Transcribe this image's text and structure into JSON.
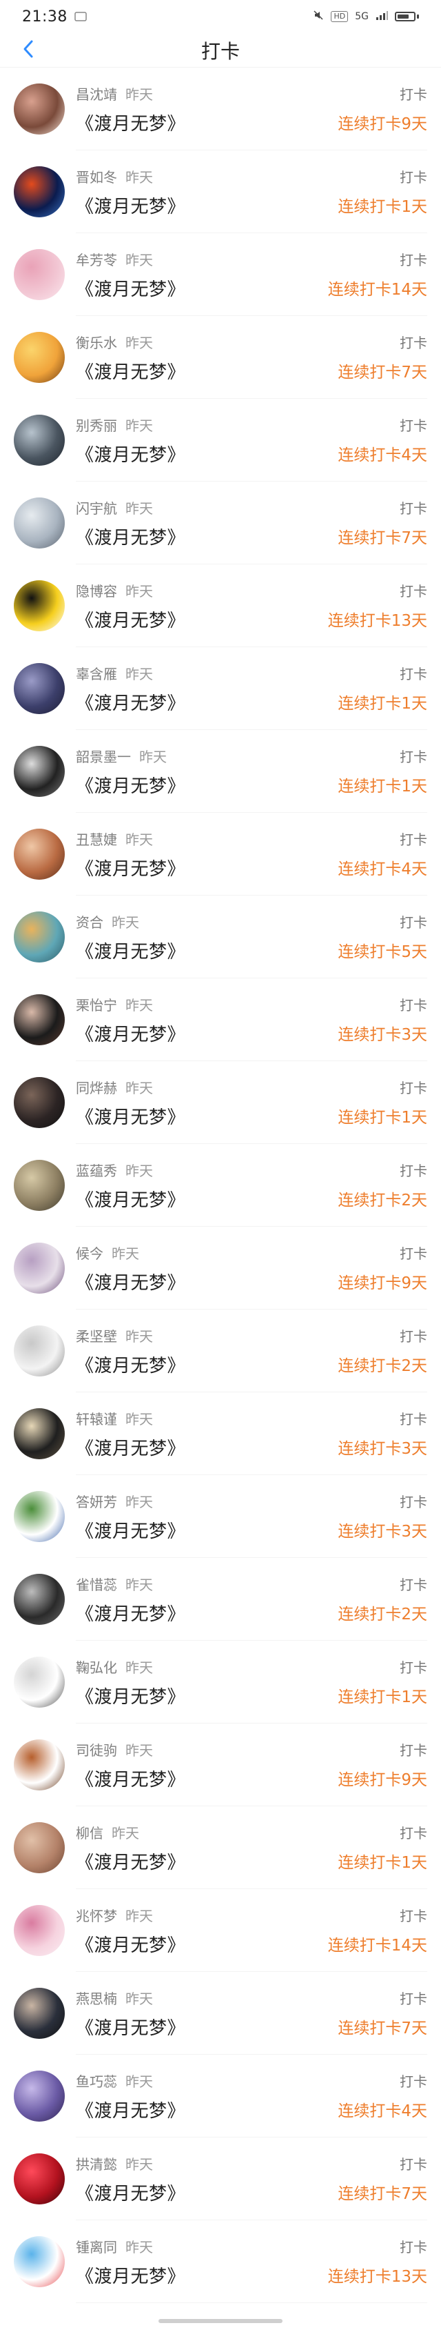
{
  "status_bar": {
    "time": "21:38",
    "network_badge": "HD",
    "signal_text": "5G"
  },
  "nav": {
    "title": "打卡",
    "back_icon": "chevron-left-icon"
  },
  "colors": {
    "accent": "#2f8cff",
    "streak": "#ee7e2d"
  },
  "entries": [
    {
      "name": "昌沈靖",
      "time": "昨天",
      "book": "《渡月无梦》",
      "action": "打卡",
      "streak": "连续打卡9天",
      "avatar_colors": [
        "#7a4a3a",
        "#d8a08e",
        "#f6e3d6"
      ]
    },
    {
      "name": "晋如冬",
      "time": "昨天",
      "book": "《渡月无梦》",
      "action": "打卡",
      "streak": "连续打卡1天",
      "avatar_colors": [
        "#0b1c4f",
        "#e44b1d",
        "#3a73c2"
      ]
    },
    {
      "name": "牟芳苓",
      "time": "昨天",
      "book": "《渡月无梦》",
      "action": "打卡",
      "streak": "连续打卡14天",
      "avatar_colors": [
        "#f2c6d3",
        "#e9a2b7",
        "#fbe8ee"
      ]
    },
    {
      "name": "衡乐水",
      "time": "昨天",
      "book": "《渡月无梦》",
      "action": "打卡",
      "streak": "连续打卡7天",
      "avatar_colors": [
        "#f0a33a",
        "#fbd46b",
        "#6d3c12"
      ]
    },
    {
      "name": "别秀丽",
      "time": "昨天",
      "book": "《渡月无梦》",
      "action": "打卡",
      "streak": "连续打卡4天",
      "avatar_colors": [
        "#4a5560",
        "#b7c3cd",
        "#1f262e"
      ]
    },
    {
      "name": "闪宇航",
      "time": "昨天",
      "book": "《渡月无梦》",
      "action": "打卡",
      "streak": "连续打卡7天",
      "avatar_colors": [
        "#a9b4c0",
        "#e6ebef",
        "#5a6470"
      ]
    },
    {
      "name": "隐博容",
      "time": "昨天",
      "book": "《渡月无梦》",
      "action": "打卡",
      "streak": "连续打卡13天",
      "avatar_colors": [
        "#f6cf1e",
        "#111111",
        "#ffffff"
      ]
    },
    {
      "name": "辜含雁",
      "time": "昨天",
      "book": "《渡月无梦》",
      "action": "打卡",
      "streak": "连续打卡1天",
      "avatar_colors": [
        "#3c3f6b",
        "#9a9bc7",
        "#1d1e35"
      ]
    },
    {
      "name": "韶景墨一",
      "time": "昨天",
      "book": "《渡月无梦》",
      "action": "打卡",
      "streak": "连续打卡1天",
      "avatar_colors": [
        "#222222",
        "#dddddd",
        "#777777"
      ]
    },
    {
      "name": "丑慧婕",
      "time": "昨天",
      "book": "《渡月无梦》",
      "action": "打卡",
      "streak": "连续打卡4天",
      "avatar_colors": [
        "#b96a42",
        "#efc7a6",
        "#5b2f1a"
      ]
    },
    {
      "name": "资合",
      "time": "昨天",
      "book": "《渡月无梦》",
      "action": "打卡",
      "streak": "连续打卡5天",
      "avatar_colors": [
        "#5fa7b6",
        "#e9b35c",
        "#2d5b67"
      ]
    },
    {
      "name": "栗怡宁",
      "time": "昨天",
      "book": "《渡月无梦》",
      "action": "打卡",
      "streak": "连续打卡3天",
      "avatar_colors": [
        "#1b1b1b",
        "#d9b9a9",
        "#5a3b30"
      ]
    },
    {
      "name": "同烨赫",
      "time": "昨天",
      "book": "《渡月无梦》",
      "action": "打卡",
      "streak": "连续打卡1天",
      "avatar_colors": [
        "#2c2424",
        "#7b6559",
        "#111111"
      ]
    },
    {
      "name": "蓝蕴秀",
      "time": "昨天",
      "book": "《渡月无梦》",
      "action": "打卡",
      "streak": "连续打卡2天",
      "avatar_colors": [
        "#8d7f62",
        "#d6c9a6",
        "#3f3a2c"
      ]
    },
    {
      "name": "候今",
      "time": "昨天",
      "book": "《渡月无梦》",
      "action": "打卡",
      "streak": "连续打卡9天",
      "avatar_colors": [
        "#e7dfe9",
        "#b79fc2",
        "#6d4f7b"
      ]
    },
    {
      "name": "柔坚壁",
      "time": "昨天",
      "book": "《渡月无梦》",
      "action": "打卡",
      "streak": "连续打卡2天",
      "avatar_colors": [
        "#f3f3f3",
        "#c8c8c8",
        "#8a8a8a"
      ]
    },
    {
      "name": "轩辕谨",
      "time": "昨天",
      "book": "《渡月无梦》",
      "action": "打卡",
      "streak": "连续打卡3天",
      "avatar_colors": [
        "#1f1f1f",
        "#e6d7b7",
        "#5e5240"
      ]
    },
    {
      "name": "答妍芳",
      "time": "昨天",
      "book": "《渡月无梦》",
      "action": "打卡",
      "streak": "连续打卡3天",
      "avatar_colors": [
        "#ffffff",
        "#4b8e3a",
        "#3a62a8"
      ]
    },
    {
      "name": "雀惜蕊",
      "time": "昨天",
      "book": "《渡月无梦》",
      "action": "打卡",
      "streak": "连续打卡2天",
      "avatar_colors": [
        "#2a2a2a",
        "#bdbdbd",
        "#6b6b6b"
      ]
    },
    {
      "name": "鞠弘化",
      "time": "昨天",
      "book": "《渡月无梦》",
      "action": "打卡",
      "streak": "连续打卡1天",
      "avatar_colors": [
        "#ffffff",
        "#d4d4d4",
        "#4a4a4a"
      ]
    },
    {
      "name": "司徒驹",
      "time": "昨天",
      "book": "《渡月无梦》",
      "action": "打卡",
      "streak": "连续打卡9天",
      "avatar_colors": [
        "#ffffff",
        "#b65f2d",
        "#6b3b1d"
      ]
    },
    {
      "name": "柳信",
      "time": "昨天",
      "book": "《渡月无梦》",
      "action": "打卡",
      "streak": "连续打卡1天",
      "avatar_colors": [
        "#b48269",
        "#e1c0a8",
        "#6d4532"
      ]
    },
    {
      "name": "兆怀梦",
      "time": "昨天",
      "book": "《渡月无梦》",
      "action": "打卡",
      "streak": "连续打卡14天",
      "avatar_colors": [
        "#f6d3df",
        "#d97ca0",
        "#fbeef3"
      ]
    },
    {
      "name": "燕思楠",
      "time": "昨天",
      "book": "《渡月无梦》",
      "action": "打卡",
      "streak": "连续打卡7天",
      "avatar_colors": [
        "#2a2f3b",
        "#c9b5a4",
        "#111111"
      ]
    },
    {
      "name": "鱼巧蕊",
      "time": "昨天",
      "book": "《渡月无梦》",
      "action": "打卡",
      "streak": "连续打卡4天",
      "avatar_colors": [
        "#6a5aa5",
        "#c6b9e9",
        "#2f2451"
      ]
    },
    {
      "name": "拱清懿",
      "time": "昨天",
      "book": "《渡月无梦》",
      "action": "打卡",
      "streak": "连续打卡7天",
      "avatar_colors": [
        "#b3121f",
        "#ff4a5a",
        "#3a0308"
      ]
    },
    {
      "name": "锺离同",
      "time": "昨天",
      "book": "《渡月无梦》",
      "action": "打卡",
      "streak": "连续打卡13天",
      "avatar_colors": [
        "#ffffff",
        "#5ab3ea",
        "#e5484d"
      ]
    }
  ]
}
